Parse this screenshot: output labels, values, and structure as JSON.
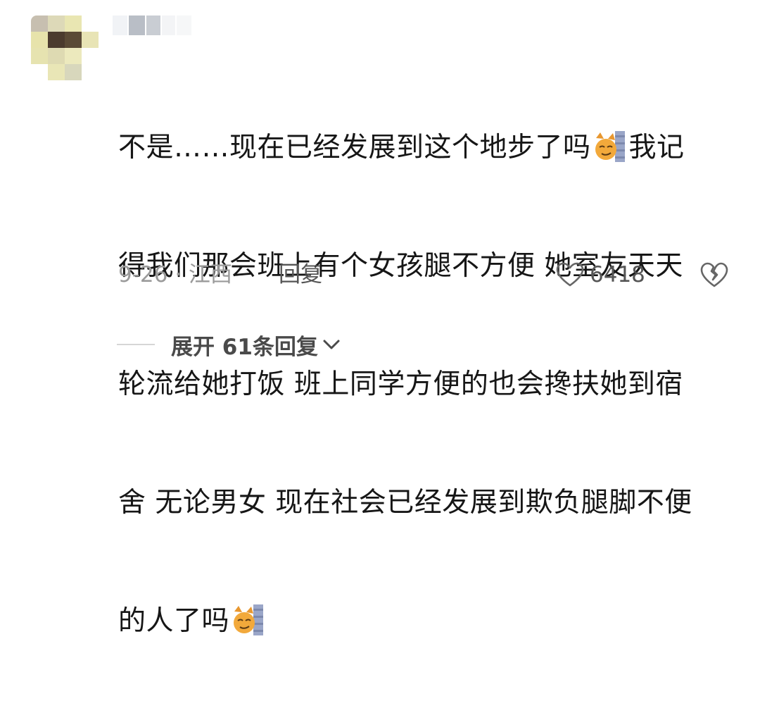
{
  "comment": {
    "lines": [
      {
        "text_a": "不是……现在已经发展到这个地步了吗",
        "emoji": "cat-smug-emoji",
        "text_b": "我记"
      },
      {
        "text_a": "得我们那会班上有个女孩腿不方便 她室友天天"
      },
      {
        "text_a": "轮流给她打饭 班上同学方便的也会搀扶她到宿"
      },
      {
        "text_a": "舍 无论男女  现在社会已经发展到欺负腿脚不便"
      },
      {
        "text_a": "的人了吗",
        "emoji": "cat-smug-emoji"
      }
    ],
    "date_location": "9-26 · 江西",
    "reply_label": "回复",
    "like_count": "6418",
    "expand_label": "展开 61条回复"
  },
  "icons": {
    "like": "heart-outline-icon",
    "dislike": "broken-heart-icon",
    "expand": "chevron-down-icon"
  },
  "colors": {
    "text": "#161616",
    "meta": "#9a9a9a",
    "action": "#555555",
    "emoji_cat": "#f0a53c"
  }
}
